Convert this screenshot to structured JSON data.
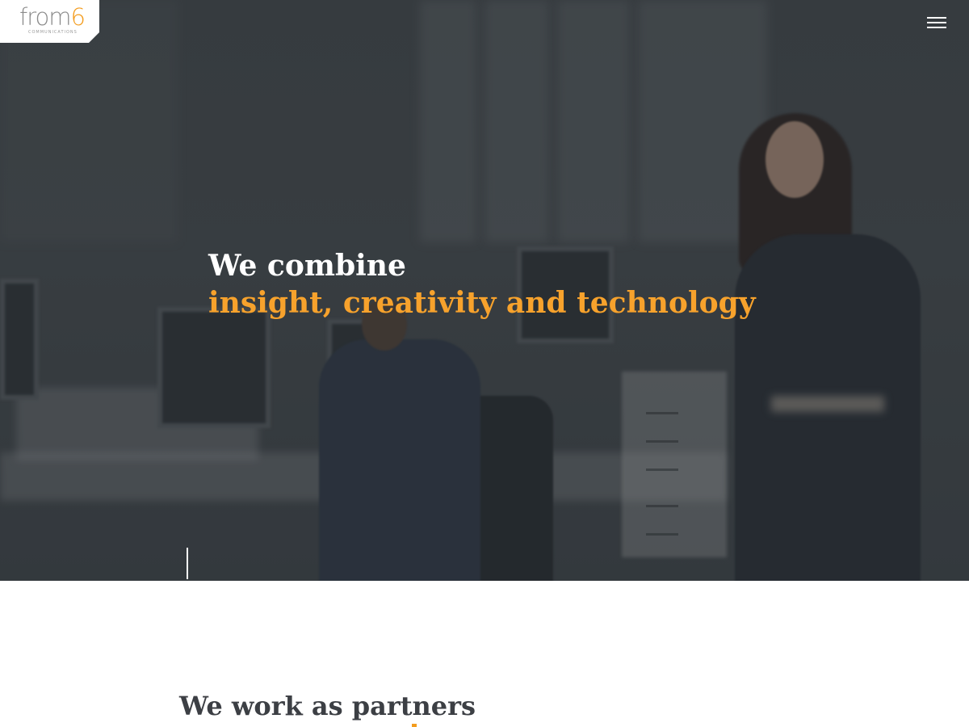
{
  "brand": {
    "logo_text": "from",
    "logo_digit": "6",
    "logo_subtext": "COMMUNICATIONS",
    "accent_color": "#f39c1d"
  },
  "header": {
    "menu_icon": "hamburger-menu-icon"
  },
  "hero": {
    "line1": "We combine",
    "line2": "insight, creativity and technology",
    "line1_color": "#ffffff",
    "line2_color": "#f7a22c"
  },
  "section": {
    "heading": "We work as partners"
  }
}
